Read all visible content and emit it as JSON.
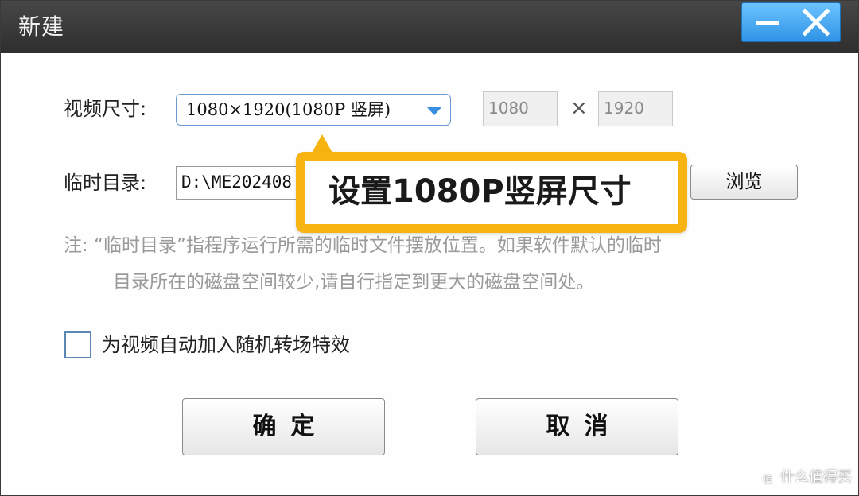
{
  "window": {
    "title": "新建",
    "minimize_icon": "minimize-icon",
    "close_icon": "close-icon",
    "accent_color": "#3fa3f0"
  },
  "video_size": {
    "label": "视频尺寸:",
    "selected": "1080×1920(1080P 竖屏)",
    "width": "1080",
    "times": "×",
    "height": "1920"
  },
  "temp_dir": {
    "label": "临时目录:",
    "value": "D:\\ME202408",
    "browse_label": "浏览"
  },
  "note": {
    "line1": "注:  “临时目录”指程序运行所需的临时文件摆放位置。如果软件默认的临时",
    "line2": "目录所在的磁盘空间较少,请自行指定到更大的磁盘空间处。"
  },
  "transition": {
    "checked": false,
    "label": "为视频自动加入随机转场特效"
  },
  "buttons": {
    "ok": "确定",
    "cancel": "取消"
  },
  "callout": {
    "text": "设置1080P竖屏尺寸",
    "color": "#f7b411"
  },
  "watermark": {
    "text": "什么值得买"
  }
}
